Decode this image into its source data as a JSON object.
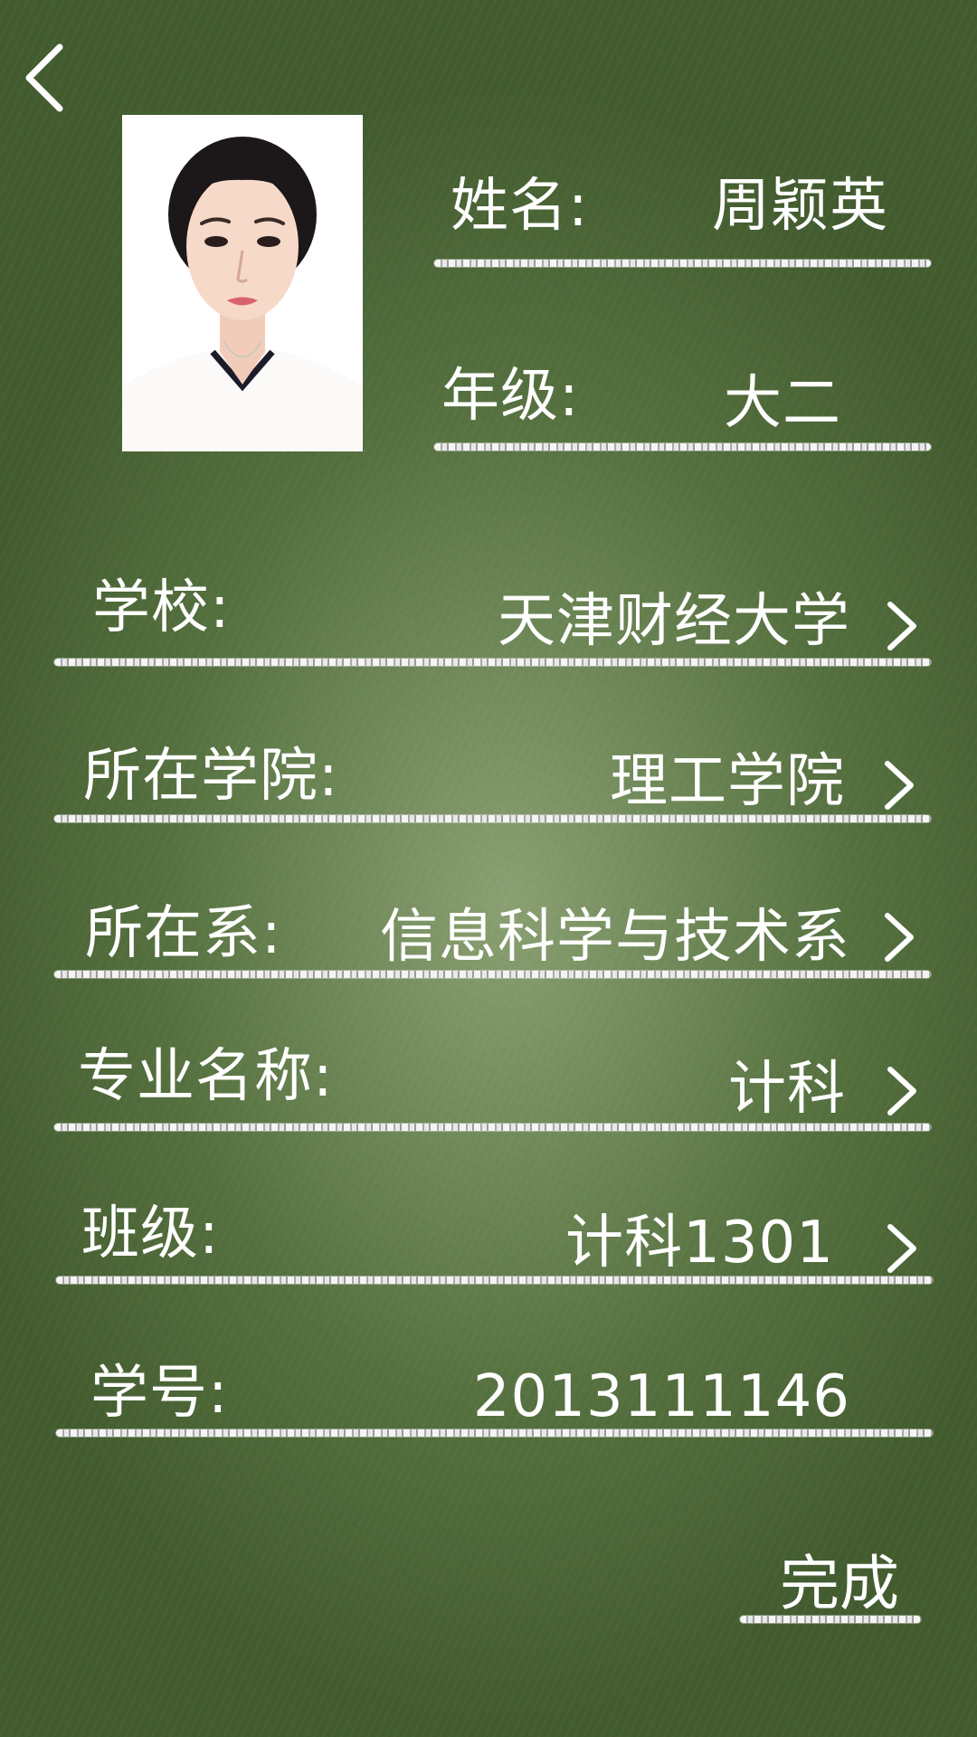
{
  "header": {
    "back_icon": "chevron-left-icon"
  },
  "profile": {
    "photo_alt": "",
    "name_label": "姓名:",
    "name_value": "周颖英",
    "grade_label": "年级:",
    "grade_value": "大二"
  },
  "fields": [
    {
      "label": "学校:",
      "value": "天津财经大学"
    },
    {
      "label": "所在学院:",
      "value": "理工学院"
    },
    {
      "label": "所在系:",
      "value": "信息科学与技术系"
    },
    {
      "label": "专业名称:",
      "value": "计科"
    },
    {
      "label": "班级:",
      "value": "计科1301"
    },
    {
      "label": "学号:",
      "value": "2013111146"
    }
  ],
  "actions": {
    "done_label": "完成"
  },
  "colors": {
    "board_center": "#8aa072",
    "board_edge": "#435c2f",
    "chalk": "#ffffff"
  }
}
